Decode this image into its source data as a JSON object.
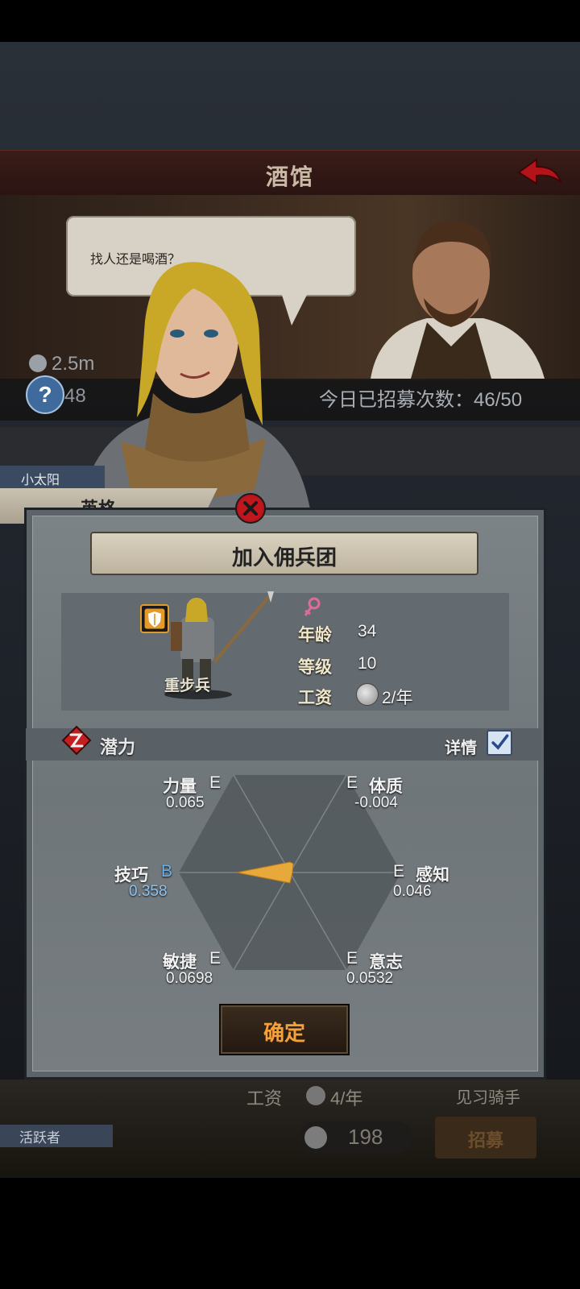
{
  "tavern": {
    "title": "酒馆",
    "speech": "找人还是喝酒？",
    "money": "2.5m",
    "count": "48",
    "recruit_count": "今日已招募次数：46/50"
  },
  "background_list": {
    "salary_label": "工资",
    "salary_value": "4/年",
    "class_name": "见习骑手",
    "tag": "活跃者",
    "price": "198",
    "recruit_button": "招募"
  },
  "hero": {
    "owner": "小太阳",
    "name": "英格"
  },
  "panel": {
    "title": "加入佣兵团",
    "unit_class": "重步兵",
    "age_label": "年龄",
    "age_value": "34",
    "level_label": "等级",
    "level_value": "10",
    "salary_label": "工资",
    "salary_value": "2/年",
    "potential_label": "潜力",
    "detail_label": "详情",
    "detail_checked": true,
    "confirm_label": "确定"
  },
  "attributes": [
    {
      "name": "力量",
      "grade": "E",
      "value": "0.065"
    },
    {
      "name": "体质",
      "grade": "E",
      "value": "-0.004"
    },
    {
      "name": "感知",
      "grade": "E",
      "value": "0.046"
    },
    {
      "name": "意志",
      "grade": "E",
      "value": "0.0532"
    },
    {
      "name": "敏捷",
      "grade": "E",
      "value": "0.0698"
    },
    {
      "name": "技巧",
      "grade": "B",
      "value": "0.358"
    }
  ],
  "colors": {
    "accent_orange": "#f5a03a",
    "close_red": "#b8141a",
    "grade_b": "#6aaee8",
    "radar_fill": "#e7a93a",
    "gender": "#e06a9a"
  }
}
